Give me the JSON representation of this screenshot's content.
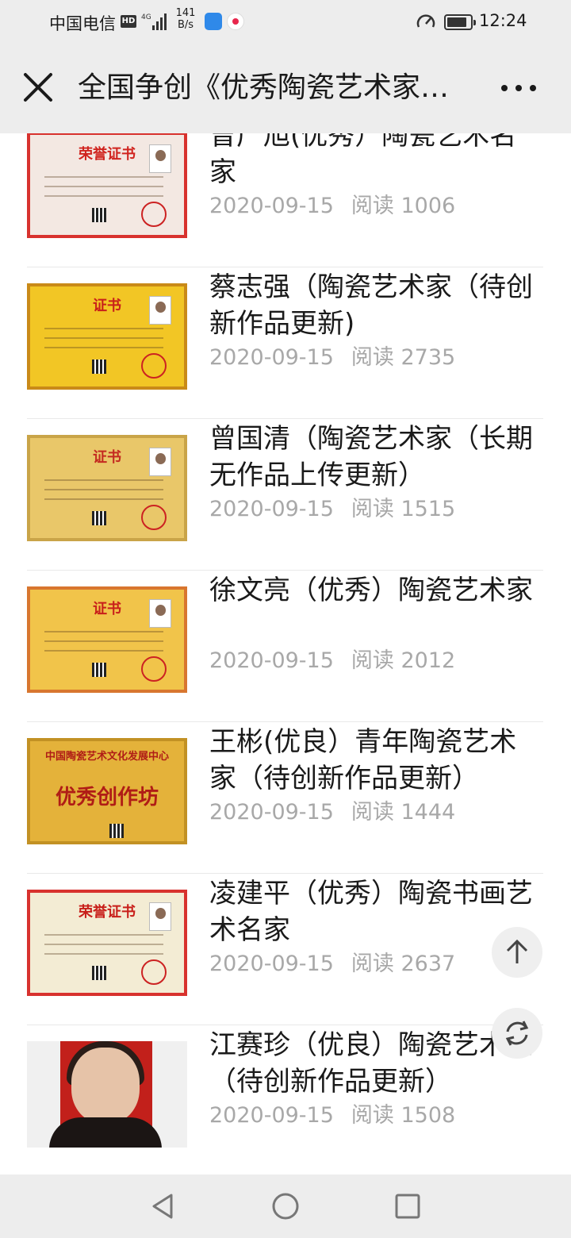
{
  "status_bar": {
    "carrier": "中国电信",
    "hd": "HD",
    "network": "4G",
    "rate_value": "141",
    "rate_unit": "B/s",
    "time": "12:24",
    "icons": [
      "signal-icon",
      "app-notification-icon",
      "weibo-icon",
      "speed-icon",
      "battery-icon"
    ]
  },
  "header": {
    "close_icon": "close-icon",
    "title": "全国争创《优秀陶瓷艺术家…",
    "more_icon": "more-icon"
  },
  "articles": [
    {
      "title": "曾广旭(优秀）陶瓷艺术名家",
      "date": "2020-09-15",
      "reads": "阅读 1006",
      "thumb_text": "荣誉证书",
      "thumb_bg": "#f3e8e2",
      "thumb_border": "#d8322e",
      "thumb_title_color": "#d0241f"
    },
    {
      "title": "蔡志强（陶瓷艺术家（待创新作品更新)",
      "date": "2020-09-15",
      "reads": "阅读 2735",
      "thumb_text": "证书",
      "thumb_bg": "#f2c625",
      "thumb_border": "#c98a18",
      "thumb_title_color": "#c81f1a"
    },
    {
      "title": "曾国清（陶瓷艺术家（长期无作品上传更新）",
      "date": "2020-09-15",
      "reads": "阅读 1515",
      "thumb_text": "证书",
      "thumb_bg": "#e9c769",
      "thumb_border": "#c9a448",
      "thumb_title_color": "#c42a20"
    },
    {
      "title": "徐文亮（优秀）陶瓷艺术家",
      "date": "2020-09-15",
      "reads": "阅读 2012",
      "thumb_text": "证书",
      "thumb_bg": "#f1c44a",
      "thumb_border": "#d8762f",
      "thumb_title_color": "#c81f1a"
    },
    {
      "title": "王彬(优良）青年陶瓷艺术家（待创新作品更新）",
      "date": "2020-09-15",
      "reads": "阅读 1444",
      "thumb_text": "中国陶瓷艺术文化发展中心",
      "thumb_text2": "优秀创作坊",
      "thumb_bg": "#e4b23a",
      "thumb_border": "#c29124",
      "thumb_title_color": "#b01d16"
    },
    {
      "title": "凌建平（优秀）陶瓷书画艺术名家",
      "date": "2020-09-15",
      "reads": "阅读 2637",
      "thumb_text": "荣誉证书",
      "thumb_bg": "#f3ecd4",
      "thumb_border": "#d8322e",
      "thumb_title_color": "#c81f1a"
    },
    {
      "title": "江赛珍（优良）陶瓷艺术家（待创新作品更新）",
      "date": "2020-09-15",
      "reads": "阅读 1508",
      "thumb_text": "",
      "thumb_bg": "#c2201b",
      "thumb_border": "#c2201b",
      "thumb_title_color": "#ffffff"
    }
  ],
  "floating": {
    "top_icon": "arrow-up-icon",
    "refresh_icon": "refresh-icon"
  },
  "nav": {
    "back_icon": "back-triangle-icon",
    "home_icon": "home-circle-icon",
    "recent_icon": "recent-square-icon"
  }
}
